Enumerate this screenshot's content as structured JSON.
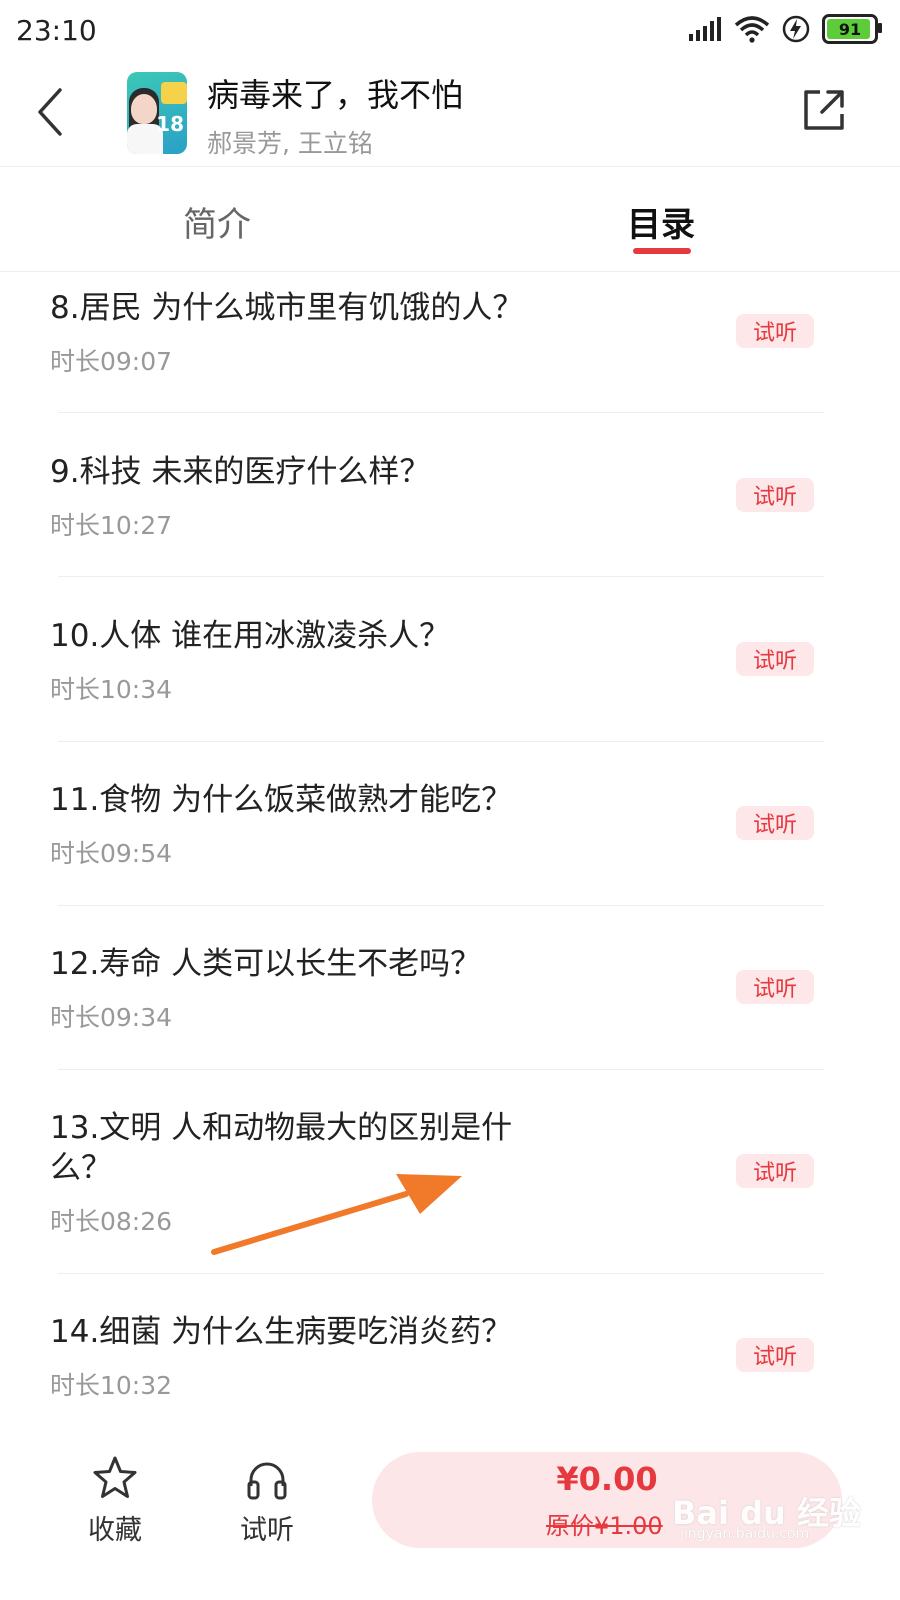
{
  "status_bar": {
    "time": "23:10",
    "battery": "91"
  },
  "header": {
    "title": "病毒来了，我不怕",
    "authors": "郝景芳, 王立铭",
    "cover_number": "18"
  },
  "tabs": [
    {
      "label": "简介",
      "selected": false
    },
    {
      "label": "目录",
      "selected": true
    }
  ],
  "episodes": [
    {
      "title": "8.居民  为什么城市里有饥饿的人？",
      "duration": "时长09:07",
      "badge": "试听"
    },
    {
      "title": "9.科技  未来的医疗什么样？",
      "duration": "时长10:27",
      "badge": "试听"
    },
    {
      "title": "10.人体  谁在用冰激凌杀人？",
      "duration": "时长10:34",
      "badge": "试听"
    },
    {
      "title": "11.食物  为什么饭菜做熟才能吃？",
      "duration": "时长09:54",
      "badge": "试听"
    },
    {
      "title": "12.寿命  人类可以长生不老吗？",
      "duration": "时长09:34",
      "badge": "试听"
    },
    {
      "title": "13.文明  人和动物最大的区别是什么？",
      "duration": "时长08:26",
      "badge": "试听"
    },
    {
      "title": "14.细菌  为什么生病要吃消炎药？",
      "duration": "时长10:32",
      "badge": "试听"
    }
  ],
  "bottom_bar": {
    "favorite_label": "收藏",
    "trial_label": "试听",
    "price": "¥0.00",
    "original_price": "原价¥1.00"
  },
  "watermark": {
    "text": "Bai du 经验",
    "url": "jingyan.baidu.com"
  },
  "colors": {
    "accent": "#e5393f",
    "badge_bg": "#fde7e8",
    "arrow": "#f07a2a",
    "battery": "#5ccd38"
  }
}
